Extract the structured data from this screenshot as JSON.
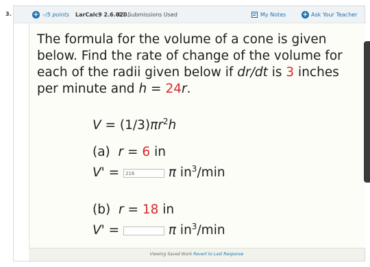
{
  "question": {
    "number": "3.",
    "points": "–/5 points",
    "code": "LarCalc9 2.6.020.",
    "submissions": "0/1 Submissions Used",
    "my_notes": "My Notes",
    "ask_teacher": "Ask Your Teacher"
  },
  "prompt": {
    "p1": "The formula for the volume of a cone is given below. Find the rate of change of the volume for each of the radii given below if ",
    "drdt": "dr/dt",
    "p2": " is ",
    "rate": "3",
    "p3": " inches per minute and ",
    "h": "h",
    "p4": " = ",
    "hval": "24",
    "r": "r",
    "p5": "."
  },
  "formula": {
    "prefix": "V = (1/3)",
    "pi": "π",
    "r": "r",
    "exp": "2",
    "h": "h"
  },
  "part_a": {
    "label": "(a)",
    "r_label": "r",
    "eq": " = ",
    "r_value": "6",
    "unit_r": " in",
    "vprime": "V' = ",
    "answer": "216",
    "pi": "π",
    "unit": " in",
    "unit_exp": "3",
    "unit_tail": "/min"
  },
  "part_b": {
    "label": "(b)",
    "r_label": "r",
    "eq": " = ",
    "r_value": "18",
    "unit_r": " in",
    "vprime": "V' = ",
    "answer": "",
    "pi": "π",
    "unit": " in",
    "unit_exp": "3",
    "unit_tail": "/min"
  },
  "footer": {
    "saved": "Viewing Saved Work ",
    "revert": "Revert to Last Response"
  },
  "colors": {
    "accent": "#1b6fb0",
    "highlight": "#d8262c",
    "panel": "#fdfdf7"
  }
}
